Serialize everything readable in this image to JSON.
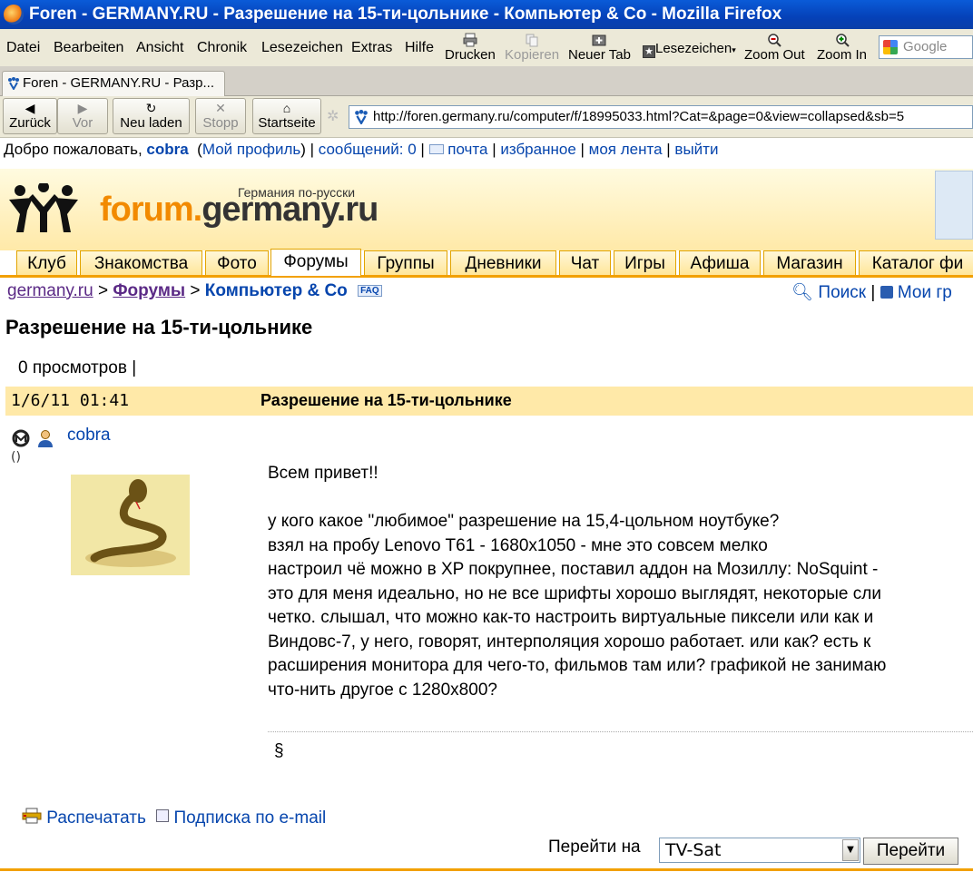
{
  "window": {
    "title": "Foren - GERMANY.RU - Разрешение на 15-ти-цольнике - Компьютер & Co - Mozilla Firefox"
  },
  "menu": [
    "Datei",
    "Bearbeiten",
    "Ansicht",
    "Chronik",
    "Lesezeichen",
    "Extras",
    "Hilfe"
  ],
  "toolbar": {
    "print": "Drucken",
    "copy": "Kopieren",
    "new_tab": "Neuer Tab",
    "bookmarks": "Lesezeichen",
    "zoom_out": "Zoom Out",
    "zoom_in": "Zoom In",
    "search_placeholder": "Google"
  },
  "tab": {
    "label": "Foren - GERMANY.RU - Разр..."
  },
  "nav": {
    "back": "Zurück",
    "forward": "Vor",
    "reload": "Neu laden",
    "stop": "Stopp",
    "home": "Startseite",
    "url": "http://foren.germany.ru/computer/f/18995033.html?Cat=&page=0&view=collapsed&sb=5"
  },
  "welcome": {
    "greeting": "Добро пожаловать,",
    "user": "cobra",
    "profile": "Мой профиль",
    "messages": "сообщений: 0",
    "mail": "почта",
    "favorites": "избранное",
    "feed": "моя лента",
    "logout": "выйти"
  },
  "logo": {
    "tagline": "Германия по-русски",
    "part1": "forum.",
    "part2": "germany.ru"
  },
  "site_tabs": [
    "Клуб",
    "Знакомства",
    "Фото",
    "Форумы",
    "Группы",
    "Дневники",
    "Чат",
    "Игры",
    "Афиша",
    "Магазин",
    "Каталог фи"
  ],
  "breadcrumb": {
    "home": "germany.ru",
    "forums": "Форумы",
    "section": "Компьютер & Co",
    "faq": "FAQ",
    "search": "Поиск",
    "my": "Мои гр"
  },
  "thread": {
    "title": "Разрешение на 15-ти-цольнике",
    "views": "0 просмотров |"
  },
  "post": {
    "date": "1/6/11 01:41",
    "subject": "Разрешение на 15-ти-цольнике",
    "author": "cobra",
    "rank": "()",
    "body": [
      "Всем привет!!",
      "",
      "у кого какое \"любимое\" разрешение на 15,4-цольном ноутбуке?",
      "взял на пробу Lenovo T61 - 1680x1050 - мне это совсем мелко",
      "настроил чё можно в XP покрупнее, поставил аддон на Мозиллу: NoSquint -",
      "это для меня идеально, но не все шрифты хорошо выглядят, некоторые сли",
      "четко. слышал, что можно как-то настроить виртуальные пиксели или как и",
      "Виндовс-7, у него, говорят, интерполяция хорошо работает. или как? есть к",
      "расширения монитора для чего-то, фильмов там или? графикой не занимаю",
      "что-нить другое с 1280x800?"
    ],
    "signature": "§"
  },
  "footer": {
    "print": "Распечатать",
    "subscribe": "Подписка по e-mail",
    "jump_label": "Перейти на",
    "jump_value": "TV-Sat",
    "jump_button": "Перейти"
  },
  "colors": {
    "accent": "#f2a000",
    "link": "#0645ad",
    "title_bar": "#0541b8",
    "post_header": "#ffe9a8"
  }
}
